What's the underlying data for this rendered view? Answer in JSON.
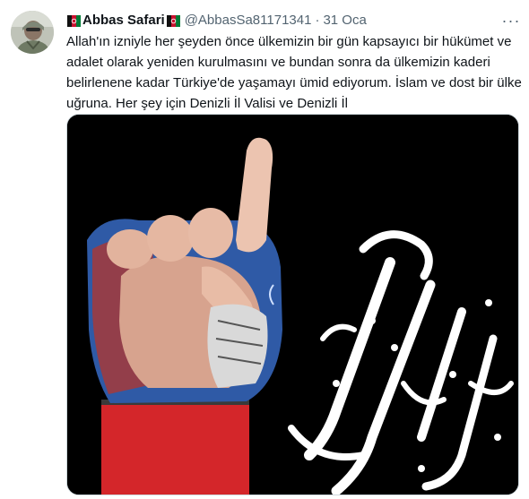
{
  "tweet": {
    "author_name": "Abbas Safari",
    "handle": "@AbbasSa81171341",
    "separator": "·",
    "date": "31 Oca",
    "more_label": "···",
    "text": "Allah'ın izniyle her şeyden önce ülkemizin bir gün kapsayıcı bir hükümet ve\nadalet olarak yeniden kurulmasını ve bundan sonra da ülkemizin kaderi\nbelirlenene kadar Türkiye'de yaşamayı ümid ediyorum. İslam ve dost bir ülke\nuğruna. Her şey için Denizli İl Valisi ve Denizli İl"
  },
  "icons": {
    "avatar": "avatar-photo",
    "flag_left": "afghanistan-flag-icon",
    "flag_right": "afghanistan-flag-icon",
    "more": "more-options-icon"
  },
  "colors": {
    "text_primary": "#0f1419",
    "text_secondary": "#536471",
    "media_background": "#000000"
  }
}
